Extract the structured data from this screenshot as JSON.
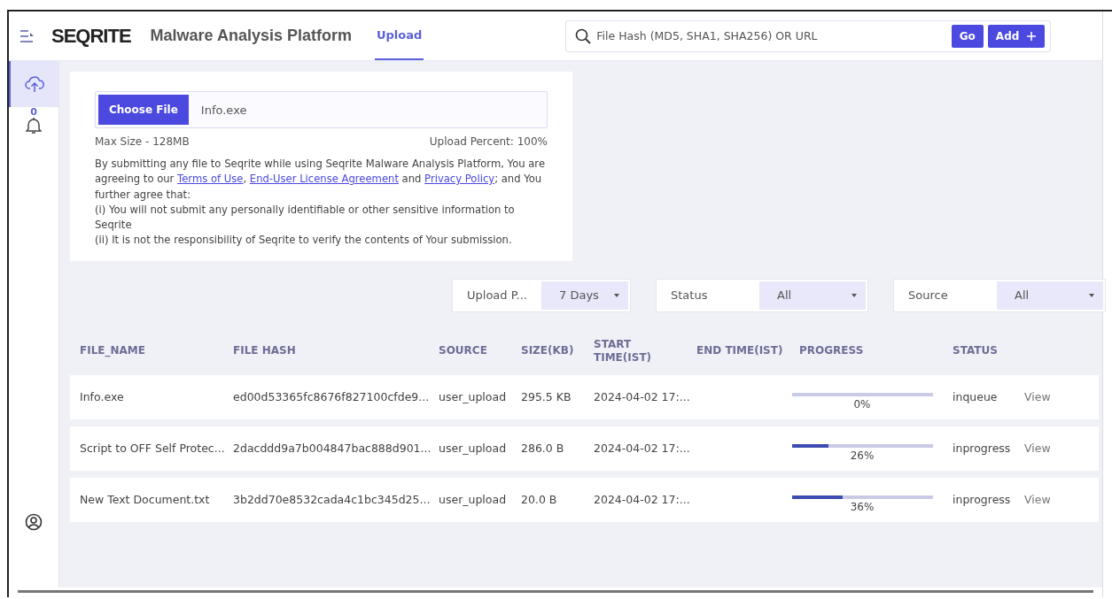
{
  "header": {
    "brand": "SEQRITE",
    "title": "Malware Analysis Platform",
    "tabs": [
      {
        "label": "Upload",
        "selected": true
      }
    ]
  },
  "search": {
    "placeholder": "File Hash (MD5, SHA1, SHA256) OR URL"
  },
  "header_buttons": [
    {
      "kind": "go",
      "label": "Go"
    },
    {
      "kind": "add",
      "label": "Add"
    }
  ],
  "sidebar": {
    "items": [
      {
        "kind": "upload",
        "selected": true
      },
      {
        "kind": "bell",
        "selected": false,
        "badge": "0"
      },
      {
        "kind": "user",
        "selected": false
      }
    ]
  },
  "upload": {
    "button": "Choose File",
    "file_name": "Info.exe",
    "max_size": "Max Size - 128MB",
    "upload_percent": "Upload Percent: 100%",
    "disclaimer": [
      [
        {
          "kind": "text",
          "text": "By submitting any file to Seqrite while using Seqrite Malware Analysis Platform, You are agreeing to our "
        },
        {
          "kind": "link",
          "text": "Terms of Use"
        },
        {
          "kind": "text",
          "text": ", "
        },
        {
          "kind": "link",
          "text": "End-User License Agreement"
        },
        {
          "kind": "text",
          "text": " and "
        },
        {
          "kind": "link",
          "text": "Privacy Policy"
        },
        {
          "kind": "text",
          "text": "; and You further agree that:"
        }
      ],
      [
        {
          "kind": "text",
          "text": "(i) You will not submit any personally identifiable or other sensitive information to Seqrite"
        }
      ],
      [
        {
          "kind": "text",
          "text": "(ii) It is not the responsibility of Seqrite to verify the contents of Your submission."
        }
      ]
    ]
  },
  "filters": [
    {
      "label": "Upload P...",
      "value": "7 Days"
    },
    {
      "label": "Status",
      "value": "All"
    },
    {
      "label": "Source",
      "value": "All"
    }
  ],
  "table": {
    "columns": [
      "FILE_NAME",
      "FILE HASH",
      "SOURCE",
      "SIZE(KB)",
      "START TIME(IST)",
      "END TIME(IST)",
      "PROGRESS",
      "STATUS"
    ],
    "rows": [
      {
        "file_name": "Info.exe",
        "file_hash": "ed00d53365fc8676f827100cfde9...",
        "source": "user_upload",
        "size": "295.5 KB",
        "start_time": "2024-04-02 17:...",
        "level": 0,
        "progress": "0%",
        "status": "inqueue",
        "action": "View"
      },
      {
        "file_name": "Script to OFF Self Protec...",
        "file_hash": "2dacddd9a7b004847bac888d901...",
        "source": "user_upload",
        "size": "286.0 B",
        "start_time": "2024-04-02 17:...",
        "level": 0.26,
        "progress": "26%",
        "status": "inprogress",
        "action": "View"
      },
      {
        "file_name": "New Text Document.txt",
        "file_hash": "3b2dd70e8532cada4c1bc345d25...",
        "source": "user_upload",
        "size": "20.0 B",
        "start_time": "2024-04-02 17:...",
        "level": 0.36,
        "progress": "36%",
        "status": "inprogress",
        "action": "View"
      }
    ]
  }
}
